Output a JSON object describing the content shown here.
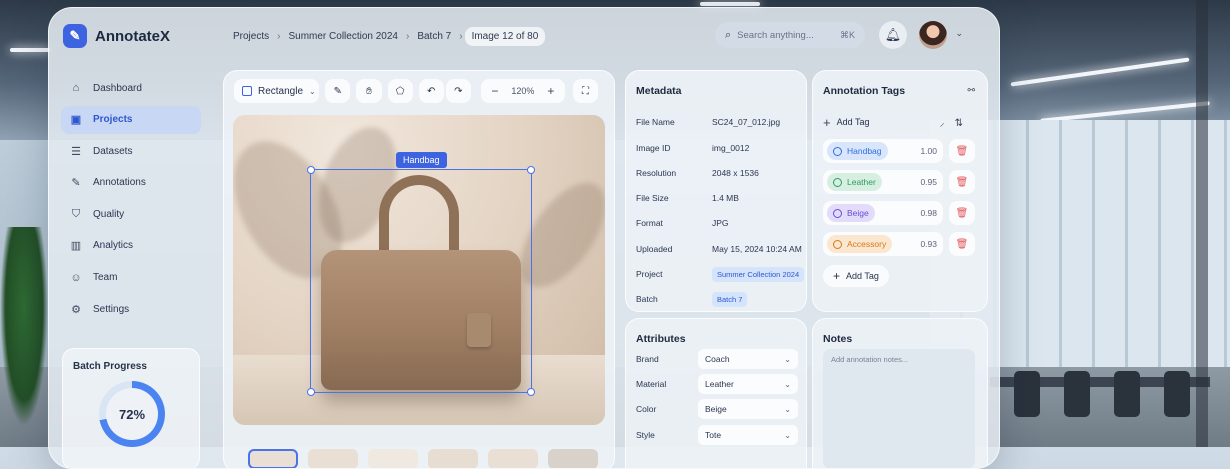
{
  "brand": {
    "name": "AnnotateX"
  },
  "sidebar": {
    "items": [
      {
        "label": "Dashboard",
        "icon": "home-icon"
      },
      {
        "label": "Projects",
        "icon": "projects-icon",
        "active": true
      },
      {
        "label": "Datasets",
        "icon": "datasets-icon"
      },
      {
        "label": "Annotations",
        "icon": "annotations-icon"
      },
      {
        "label": "Quality",
        "icon": "quality-icon"
      },
      {
        "label": "Analytics",
        "icon": "analytics-icon"
      },
      {
        "label": "Team",
        "icon": "team-icon"
      },
      {
        "label": "Settings",
        "icon": "settings-icon"
      }
    ]
  },
  "progress": {
    "title": "Batch Progress",
    "value": "72%",
    "fraction": 0.72
  },
  "breadcrumb": {
    "items": [
      "Projects",
      "Summer Collection 2024",
      "Batch 7",
      "Image 12 of 80"
    ]
  },
  "search": {
    "placeholder": "Search anything...",
    "shortcut": "⌘K"
  },
  "toolbar": {
    "shape_label": "Rectangle",
    "zoom": "120%"
  },
  "canvas": {
    "bbox_label": "Handbag"
  },
  "metadata": {
    "title": "Metadata",
    "rows": [
      {
        "key": "File Name",
        "value": "SC24_07_012.jpg"
      },
      {
        "key": "Image ID",
        "value": "img_0012"
      },
      {
        "key": "Resolution",
        "value": "2048 x 1536"
      },
      {
        "key": "File Size",
        "value": "1.4 MB"
      },
      {
        "key": "Format",
        "value": "JPG"
      },
      {
        "key": "Uploaded",
        "value": "May 15, 2024 10:24 AM"
      },
      {
        "key": "Project",
        "value": "Summer Collection 2024"
      },
      {
        "key": "Batch",
        "value": "Batch 7"
      }
    ]
  },
  "attributes": {
    "title": "Attributes",
    "rows": [
      {
        "key": "Brand",
        "value": "Coach"
      },
      {
        "key": "Material",
        "value": "Leather"
      },
      {
        "key": "Color",
        "value": "Beige"
      },
      {
        "key": "Style",
        "value": "Tote"
      }
    ]
  },
  "tags": {
    "title": "Annotation Tags",
    "add_label": "Add Tag",
    "items": [
      {
        "label": "Handbag",
        "score": "1.00",
        "color": "#2f6fe0",
        "bg": "#d8e5fb"
      },
      {
        "label": "Leather",
        "score": "0.95",
        "color": "#2f9a63",
        "bg": "#d6efe1"
      },
      {
        "label": "Beige",
        "score": "0.98",
        "color": "#6a4bd8",
        "bg": "#e2dcfa"
      },
      {
        "label": "Accessory",
        "score": "0.93",
        "color": "#d67a1c",
        "bg": "#fbe6cf"
      }
    ]
  },
  "notes": {
    "title": "Notes",
    "placeholder": "Add annotation notes..."
  }
}
